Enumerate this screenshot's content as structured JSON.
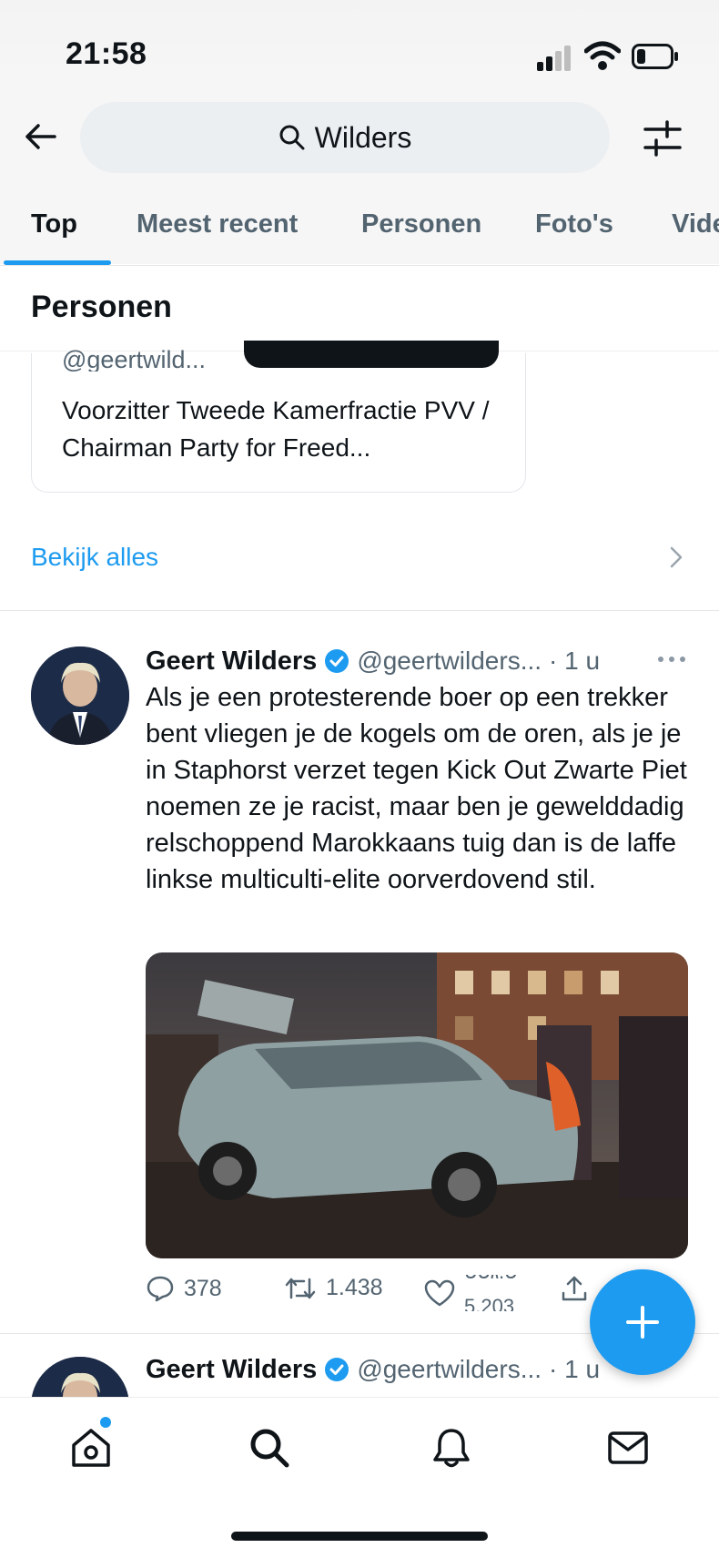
{
  "status_bar": {
    "time": "21:58"
  },
  "search": {
    "query": "Wilders"
  },
  "tabs": [
    {
      "label": "Top",
      "active": true
    },
    {
      "label": "Meest recent",
      "active": false
    },
    {
      "label": "Personen",
      "active": false
    },
    {
      "label": "Foto's",
      "active": false
    },
    {
      "label": "Vide",
      "active": false
    }
  ],
  "people_section": {
    "title": "Personen",
    "card": {
      "handle": "@geertwild...",
      "bio": "Voorzitter Tweede Kamerfractie PVV / Chairman Party for Freed..."
    },
    "view_all": "Bekijk alles"
  },
  "tweets": [
    {
      "name": "Geert Wilders",
      "handle": "@geertwilders...",
      "time": "· 1 u",
      "text": "Als je een protesterende boer op een trekker bent vliegen je de kogels om de oren, als je je in Staphorst verzet tegen Kick Out Zwarte Piet noemen ze je racist, maar ben je gewelddadig relschoppend Marokkaans tuig dan is de laffe linkse multiculti-elite oorverdovend stil.",
      "replies": "378",
      "retweets": "1.438",
      "likes_partial_top": "ט.גטט",
      "likes_partial_bottom": "5.203"
    },
    {
      "name": "Geert Wilders",
      "handle": "@geertwilders...",
      "time": "· 1 u"
    }
  ],
  "colors": {
    "accent": "#1d9bf0",
    "text": "#0f1419",
    "secondary": "#536471"
  },
  "icons": [
    "back-arrow-icon",
    "search-icon",
    "filter-icon",
    "verified-badge-icon",
    "more-icon",
    "reply-icon",
    "retweet-icon",
    "like-icon",
    "share-icon",
    "plus-icon",
    "home-icon",
    "search-nav-icon",
    "bell-icon",
    "mail-icon"
  ]
}
